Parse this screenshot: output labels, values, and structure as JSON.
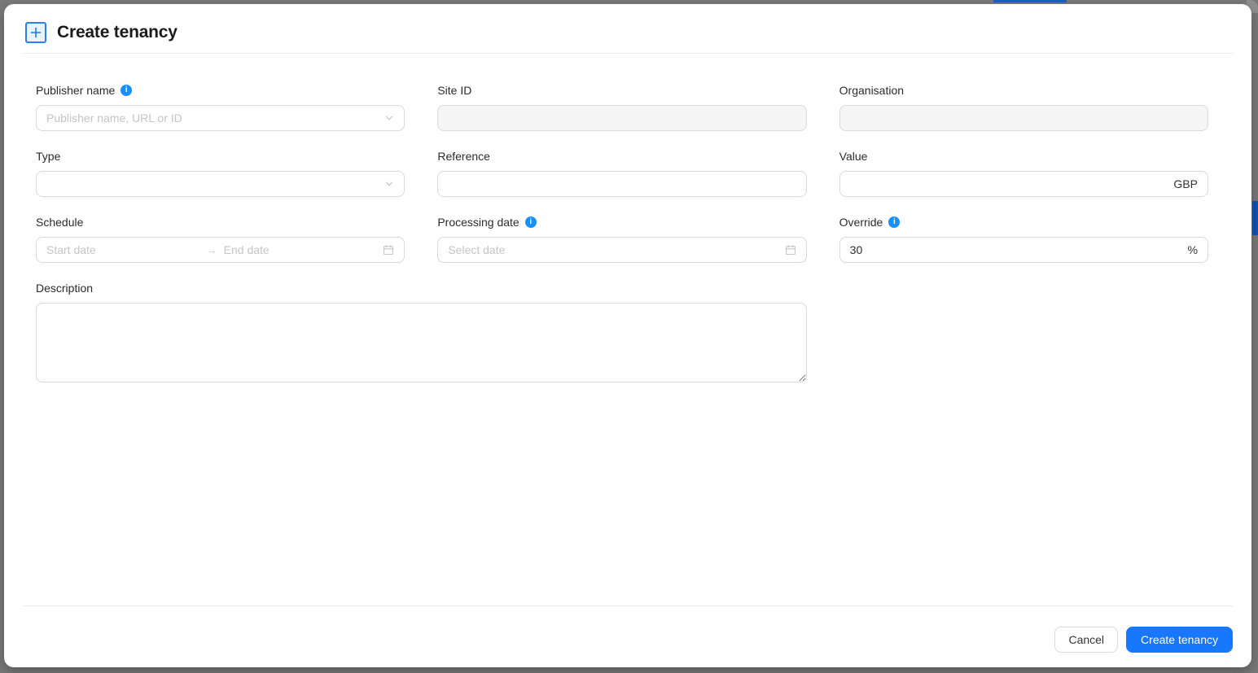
{
  "header": {
    "title": "Create tenancy",
    "icon": "plus-square-icon"
  },
  "form": {
    "publisher_name": {
      "label": "Publisher name",
      "placeholder": "Publisher name, URL or ID",
      "value": "",
      "info": true
    },
    "site_id": {
      "label": "Site ID",
      "value": "",
      "disabled": true
    },
    "organisation": {
      "label": "Organisation",
      "value": "",
      "disabled": true
    },
    "type": {
      "label": "Type",
      "value": ""
    },
    "reference": {
      "label": "Reference",
      "value": ""
    },
    "value": {
      "label": "Value",
      "value": "",
      "suffix": "GBP"
    },
    "schedule": {
      "label": "Schedule",
      "start_placeholder": "Start date",
      "end_placeholder": "End date"
    },
    "processing_date": {
      "label": "Processing date",
      "placeholder": "Select date",
      "info": true
    },
    "override": {
      "label": "Override",
      "value": "30",
      "suffix": "%",
      "info": true
    },
    "description": {
      "label": "Description",
      "value": ""
    }
  },
  "footer": {
    "cancel": "Cancel",
    "submit": "Create tenancy"
  },
  "icons": {
    "info": "info-circle-icon",
    "select": "chevron-down-icon",
    "date": "calendar-icon",
    "range_separator": "arrow-right-icon",
    "info_glyph": "i"
  },
  "colors": {
    "primary": "#1677ff",
    "info_icon": "#1890ff",
    "input_border": "#d9d9d9",
    "placeholder": "#c5c5c5",
    "divider": "#ececec",
    "disabled_bg": "#f5f5f5",
    "backdrop": "#797979",
    "behind_top_accent": "#1d5ecb",
    "behind_right_accent": "#1353b5"
  }
}
